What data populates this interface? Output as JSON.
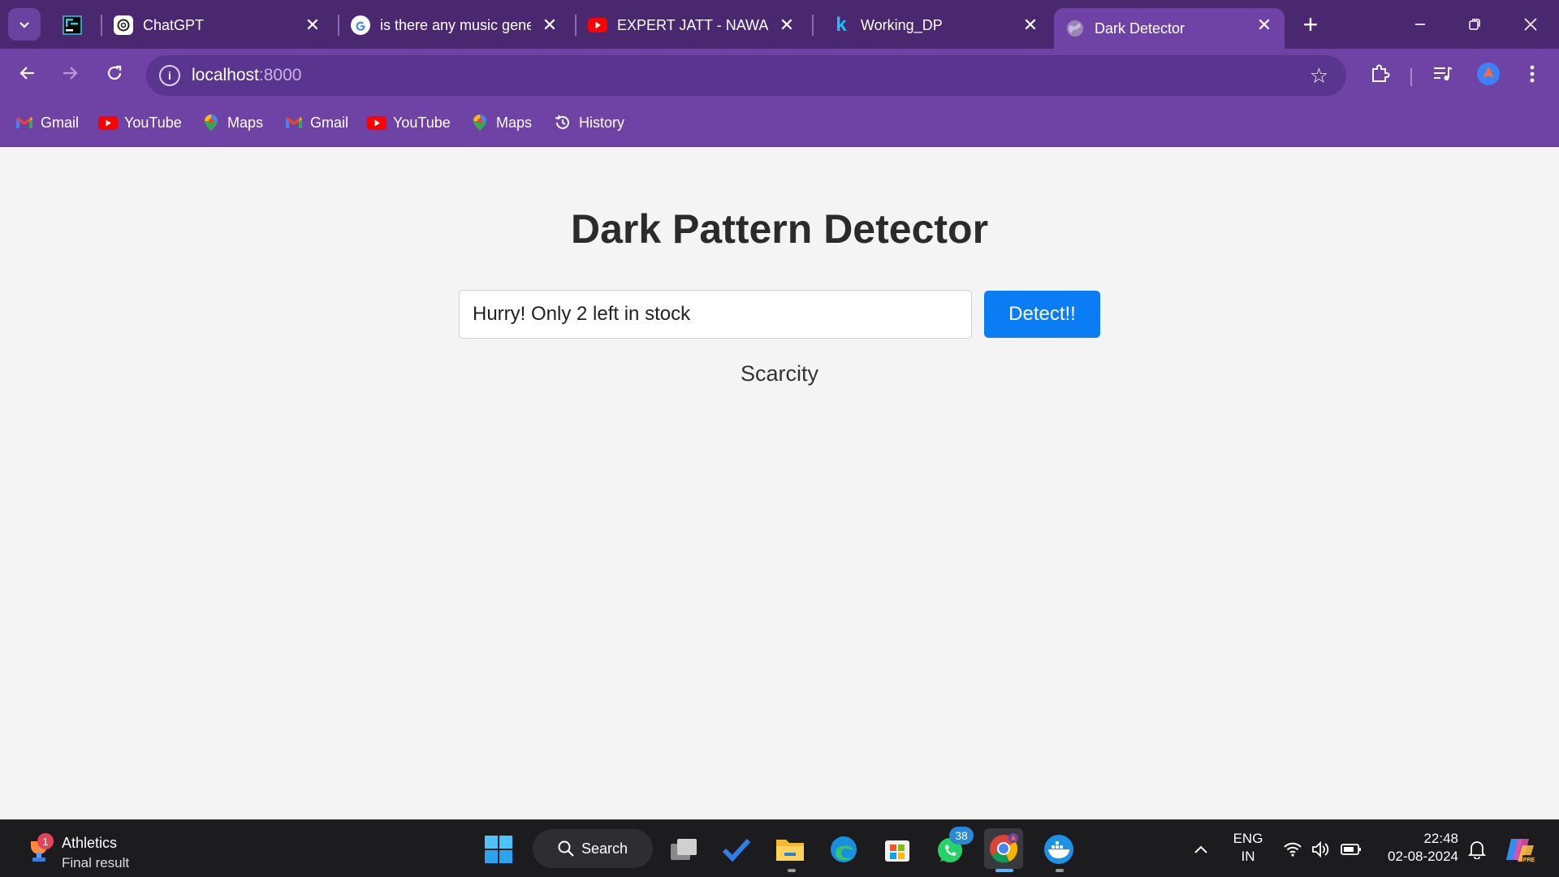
{
  "browser": {
    "tabs": [
      {
        "title": "ChatGPT",
        "icon": "chatgpt-icon"
      },
      {
        "title": "is there any music gene",
        "icon": "google-icon"
      },
      {
        "title": "EXPERT JATT - NAWAB (",
        "icon": "youtube-icon"
      },
      {
        "title": "Working_DP",
        "icon": "kaggle-icon"
      },
      {
        "title": "Dark Detector",
        "icon": "globe-icon"
      }
    ],
    "url_host": "localhost",
    "url_port": ":8000",
    "bookmarks": [
      {
        "label": "Gmail",
        "icon": "gmail-icon"
      },
      {
        "label": "YouTube",
        "icon": "youtube-icon"
      },
      {
        "label": "Maps",
        "icon": "maps-icon"
      },
      {
        "label": "Gmail",
        "icon": "gmail-icon"
      },
      {
        "label": "YouTube",
        "icon": "youtube-icon"
      },
      {
        "label": "Maps",
        "icon": "maps-icon"
      },
      {
        "label": "History",
        "icon": "history-icon"
      }
    ],
    "colors": {
      "frame": "#4a2870",
      "toolbar": "#6f43a5"
    }
  },
  "page": {
    "heading": "Dark Pattern Detector",
    "input_value": "Hurry! Only 2 left in stock",
    "button_label": "Detect!!",
    "result": "Scarcity",
    "colors": {
      "button": "#0a7cf4",
      "background": "#f4f4f4"
    }
  },
  "taskbar": {
    "weather_title": "Athletics",
    "weather_subtitle": "Final result",
    "weather_badge": "1",
    "search_label": "Search",
    "whatsapp_badge": "38",
    "lang_1": "ENG",
    "lang_2": "IN",
    "time": "22:48",
    "date": "02-08-2024"
  }
}
